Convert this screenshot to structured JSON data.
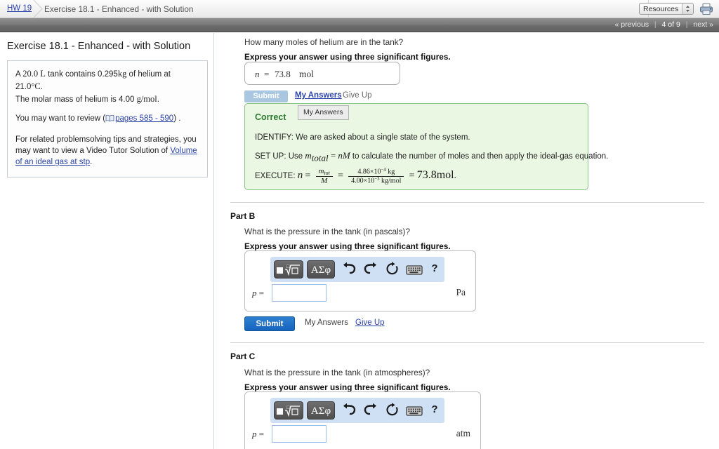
{
  "topbar": {
    "breadcrumb_link": "HW 19",
    "breadcrumb_title": "Exercise 18.1 - Enhanced - with Solution",
    "resources_label": "Resources",
    "printer_icon": "printer-icon"
  },
  "pager": {
    "previous": "« previous",
    "current": "4 of 9",
    "next": "next »",
    "divider": "|"
  },
  "sidebar": {
    "title": "Exercise 18.1 - Enhanced - with Solution",
    "problem": {
      "line1_a": "A",
      "line1_vol": "20.0 L",
      "line1_b": "tank contains 0.295",
      "line1_mass": "kg",
      "line1_c": "of helium at 21.0",
      "line1_temp": "°C",
      "line1_d": ".",
      "line2_a": "The molar mass of helium is 4.00",
      "line2_unit": "g/mol",
      "line2_b": ".",
      "review_prefix": "You may want to review (",
      "review_link": "pages 585 - 590",
      "review_suffix": ") .",
      "tips_prefix": "For related problemsolving tips and strategies, you may want to view a Video Tutor Solution of ",
      "tips_link": "Volume of an ideal gas at stp",
      "tips_suffix": "."
    },
    "book_icon": "book-icon"
  },
  "parts": {
    "a": {
      "question": "How many moles of helium are in the tank?",
      "instruction": "Express your answer using three significant figures.",
      "answer": {
        "var": "n",
        "eq": "=",
        "value": "73.8",
        "unit": "mol"
      },
      "submit_label": "Submit",
      "my_answers_label": "My Answers",
      "give_up_label": "Give Up",
      "solution": {
        "status": "Correct",
        "tab_label": "My Answers",
        "identify": "IDENTIFY: We are asked about a single state of the system.",
        "setup_prefix": "SET UP: Use",
        "setup_m": "m",
        "setup_m_sub": "total",
        "setup_eq": "=",
        "setup_nM": "nM",
        "setup_suffix": "to calculate the number of moles and then apply the ideal-gas equation.",
        "execute_prefix": "EXECUTE:",
        "execute_n": "n",
        "execute_eq1": "=",
        "frac1_num_m": "m",
        "frac1_num_sub": "tot",
        "frac1_den": "M",
        "execute_eq2": "=",
        "frac2_num_coef": "4.86",
        "frac2_num_times": "×10",
        "frac2_num_exp": "−4",
        "frac2_num_unit": "kg",
        "frac2_den_coef": "4.00",
        "frac2_den_times": "×10",
        "frac2_den_exp": "−3",
        "frac2_den_unit": "kg/mol",
        "execute_eq3": "=",
        "execute_result": "73.8mol",
        "execute_period": "."
      }
    },
    "b": {
      "heading": "Part B",
      "question": "What is the pressure in the tank (in pascals)?",
      "instruction": "Express your answer using three significant figures.",
      "input_var": "p",
      "input_eq": "=",
      "input_value": "",
      "unit": "Pa",
      "submit_label": "Submit",
      "my_answers_label": "My Answers",
      "give_up_label": "Give Up"
    },
    "c": {
      "heading": "Part C",
      "question": "What is the pressure in the tank (in atmospheres)?",
      "instruction": "Express your answer using three significant figures.",
      "input_var": "p",
      "input_eq": "=",
      "input_value": "",
      "unit": "atm"
    }
  },
  "toolbar": {
    "template_icon": "math-template-icon",
    "symbols_label": "ΑΣφ",
    "undo_icon": "undo-icon",
    "redo_icon": "redo-icon",
    "reset_icon": "reset-icon",
    "keyboard_icon": "keyboard-icon",
    "help_label": "?"
  },
  "colors": {
    "link": "#2b44a8",
    "submit_active": "#1565c0",
    "submit_disabled": "#a9c7e0",
    "correct_bg": "#eaf7e3",
    "correct_border": "#87c487",
    "correct_text": "#2e7d32",
    "toolbar_bg": "#cfe0f5"
  }
}
